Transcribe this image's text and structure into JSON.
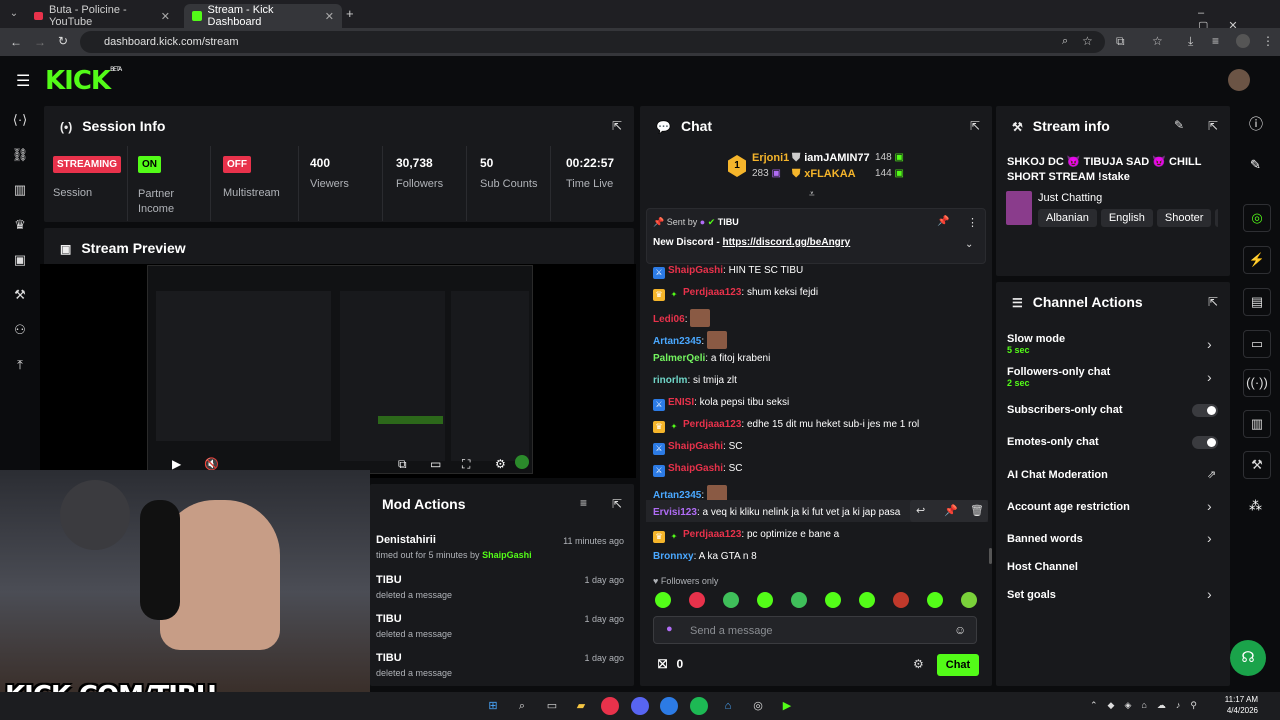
{
  "browser": {
    "tabs": [
      {
        "label": "Buta - Policine - YouTube"
      },
      {
        "label": "Stream - Kick Dashboard"
      }
    ],
    "url": "dashboard.kick.com/stream"
  },
  "logo": {
    "text": "KICK",
    "beta": "BETA"
  },
  "session": {
    "title": "Session Info",
    "statuses": [
      {
        "badge": "STREAMING",
        "label": "Session",
        "color": "#e8324b"
      },
      {
        "badge": "ON",
        "label": "Partner\nIncome",
        "color": "#53fc18"
      },
      {
        "badge": "OFF",
        "label": "Multistream",
        "color": "#e8324b"
      }
    ],
    "stats": [
      {
        "value": "400",
        "label": "Viewers"
      },
      {
        "value": "30,738",
        "label": "Followers"
      },
      {
        "value": "50",
        "label": "Sub Counts"
      },
      {
        "value": "00:22:57",
        "label": "Time Live"
      }
    ]
  },
  "preview": {
    "title": "Stream Preview"
  },
  "overlay_text": "KICK.COM/TIBU",
  "mod": {
    "title": "Mod Actions",
    "items": [
      {
        "user": "Denistahirii",
        "action": "timed out for 5 minutes by",
        "by": "ShaipGashi",
        "time": "11 minutes ago"
      },
      {
        "user": "TIBU",
        "action": "deleted a message",
        "time": "1 day ago"
      },
      {
        "user": "TIBU",
        "action": "deleted a message",
        "time": "1 day ago"
      },
      {
        "user": "TIBU",
        "action": "deleted a message",
        "time": "1 day ago"
      }
    ]
  },
  "chat": {
    "title": "Chat",
    "leaders": [
      {
        "rank": "1",
        "name": "Erjoni1",
        "count": "283"
      },
      {
        "name": "iamJAMIN77",
        "count": "148"
      },
      {
        "name": "xFLAKAA",
        "count": "144"
      }
    ],
    "pinned": {
      "sent_by_label": "Sent by",
      "sender": "TIBU",
      "text": "New Discord - ",
      "link": "https://discord.gg/beAngry"
    },
    "messages": [
      {
        "user": "ShaipGashi",
        "text": ": HIN TE SC TIBU"
      },
      {
        "user": "Perdjaaa123",
        "text": ": shum keksi fejdi"
      },
      {
        "user": "Ledi06",
        "text": ":"
      },
      {
        "user": "Artan2345",
        "text": ":"
      },
      {
        "user": "PalmerQeli",
        "text": ": a fitoj krabeni"
      },
      {
        "user": "rinorlm",
        "text": ": si tmija zlt"
      },
      {
        "user": "ENISI",
        "text": ": kola pepsi tibu seksi"
      },
      {
        "user": "Perdjaaa123",
        "text": ": edhe 15 dit mu heket sub-i jes me 1 rol"
      },
      {
        "user": "ShaipGashi",
        "text": ": SC"
      },
      {
        "user": "ShaipGashi",
        "text": ": SC"
      },
      {
        "user": "Artan2345",
        "text": ":"
      },
      {
        "user": "Ervisi123",
        "text": ": a veq ki kliku nelink ja ki fut vet ja ki jap pasa"
      },
      {
        "user": "Perdjaaa123",
        "text": ": pc optimize e bane a"
      },
      {
        "user": "Bronnxy",
        "text": ": A ka GTA n 8"
      }
    ],
    "followers_only": "Followers only",
    "placeholder": "Send a message",
    "points": "0",
    "send_label": "Chat"
  },
  "stream_info": {
    "title": "Stream info",
    "stream_title": "SHKOJ DC 😈 TIBUJA SAD 😈 CHILL SHORT STREAM !stake",
    "category": "Just Chatting",
    "tags": [
      "Albanian",
      "English",
      "Shooter",
      "a"
    ]
  },
  "channel_actions": {
    "title": "Channel Actions",
    "items": [
      {
        "label": "Slow mode",
        "sub": "5 sec"
      },
      {
        "label": "Followers-only chat",
        "sub": "2 sec"
      },
      {
        "label": "Subscribers-only chat"
      },
      {
        "label": "Emotes-only chat"
      },
      {
        "label": "AI Chat Moderation"
      },
      {
        "label": "Account age restriction"
      },
      {
        "label": "Banned words"
      },
      {
        "label": "Host Channel"
      },
      {
        "label": "Set goals"
      }
    ]
  },
  "taskbar": {
    "time": "11:17 AM",
    "date": "4/4/2026"
  }
}
